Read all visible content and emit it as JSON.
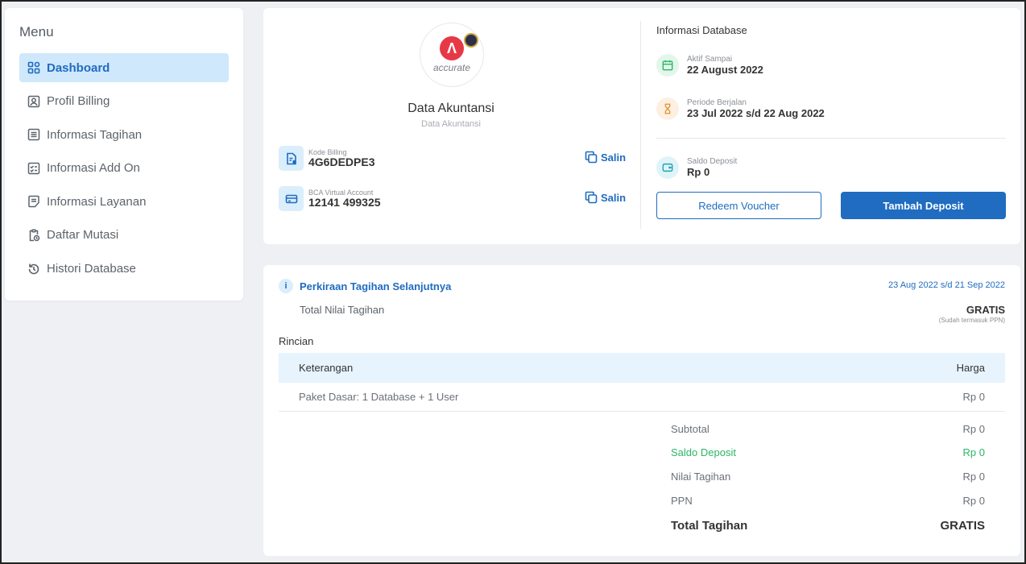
{
  "sidebar": {
    "title": "Menu",
    "items": [
      {
        "label": "Dashboard",
        "icon": "dashboard-icon"
      },
      {
        "label": "Profil Billing",
        "icon": "profile-icon"
      },
      {
        "label": "Informasi Tagihan",
        "icon": "list-icon"
      },
      {
        "label": "Informasi Add On",
        "icon": "checklist-icon"
      },
      {
        "label": "Informasi Layanan",
        "icon": "document-icon"
      },
      {
        "label": "Daftar Mutasi",
        "icon": "clipboard-clock-icon"
      },
      {
        "label": "Histori Database",
        "icon": "history-icon"
      }
    ]
  },
  "account": {
    "logo_text": "accurate",
    "title": "Data Akuntansi",
    "subtitle": "Data Akuntansi",
    "billing_code": {
      "label": "Kode Billing",
      "value": "4G6DEDPE3",
      "copy_label": "Salin"
    },
    "virtual_account": {
      "label": "BCA Virtual Account",
      "value": "12141 499325",
      "copy_label": "Salin"
    }
  },
  "database": {
    "title": "Informasi Database",
    "active_until": {
      "label": "Aktif Sampai",
      "value": "22 August 2022"
    },
    "period": {
      "label": "Periode Berjalan",
      "value": "23 Jul 2022 s/d 22 Aug 2022"
    },
    "deposit": {
      "label": "Saldo Deposit",
      "value": "Rp 0"
    },
    "redeem_label": "Redeem Voucher",
    "add_deposit_label": "Tambah Deposit"
  },
  "estimate": {
    "title": "Perkiraan Tagihan Selanjutnya",
    "period": "23 Aug 2022 s/d 21 Sep 2022",
    "total_label": "Total Nilai Tagihan",
    "total_value": "GRATIS",
    "ppn_note": "(Sudah termasuk PPN)",
    "details_title": "Rincian",
    "table": {
      "headers": [
        "Keterangan",
        "Harga"
      ],
      "rows": [
        [
          "Paket Dasar: 1 Database + 1 User",
          "Rp 0"
        ]
      ]
    },
    "summary": {
      "subtotal": {
        "label": "Subtotal",
        "value": "Rp 0"
      },
      "deposit": {
        "label": "Saldo Deposit",
        "value": "Rp 0"
      },
      "bill": {
        "label": "Nilai Tagihan",
        "value": "Rp 0"
      },
      "ppn": {
        "label": "PPN",
        "value": "Rp 0"
      },
      "total": {
        "label": "Total Tagihan",
        "value": "GRATIS"
      }
    }
  },
  "colors": {
    "accent": "#1f6cc0",
    "green": "#2db56a",
    "active_bg": "#cfe8fb"
  }
}
